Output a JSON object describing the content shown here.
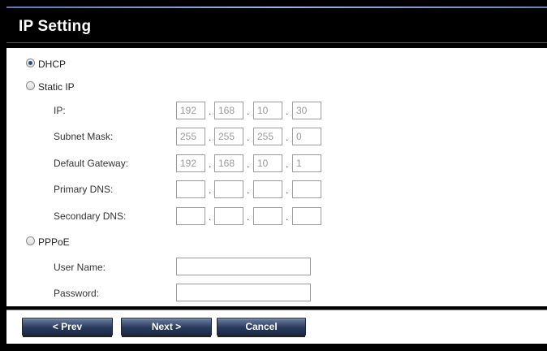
{
  "header": {
    "title": "IP Setting"
  },
  "modes": {
    "dhcp": {
      "label": "DHCP",
      "checked": true
    },
    "static": {
      "label": "Static IP",
      "checked": false
    },
    "pppoe": {
      "label": "PPPoE",
      "checked": false
    }
  },
  "static_ip": {
    "ip": {
      "label": "IP:",
      "octets": [
        "192",
        "168",
        "10",
        "30"
      ]
    },
    "subnet": {
      "label": "Subnet Mask:",
      "octets": [
        "255",
        "255",
        "255",
        "0"
      ]
    },
    "gateway": {
      "label": "Default Gateway:",
      "octets": [
        "192",
        "168",
        "10",
        "1"
      ]
    },
    "primary_dns": {
      "label": "Primary DNS:",
      "octets": [
        "",
        "",
        "",
        ""
      ]
    },
    "secondary_dns": {
      "label": "Secondary DNS:",
      "octets": [
        "",
        "",
        "",
        ""
      ]
    },
    "separator": "."
  },
  "pppoe": {
    "username": {
      "label": "User Name:",
      "value": ""
    },
    "password": {
      "label": "Password:",
      "value": ""
    }
  },
  "footer": {
    "prev_label": "< Prev",
    "next_label": "Next >",
    "cancel_label": "Cancel"
  }
}
